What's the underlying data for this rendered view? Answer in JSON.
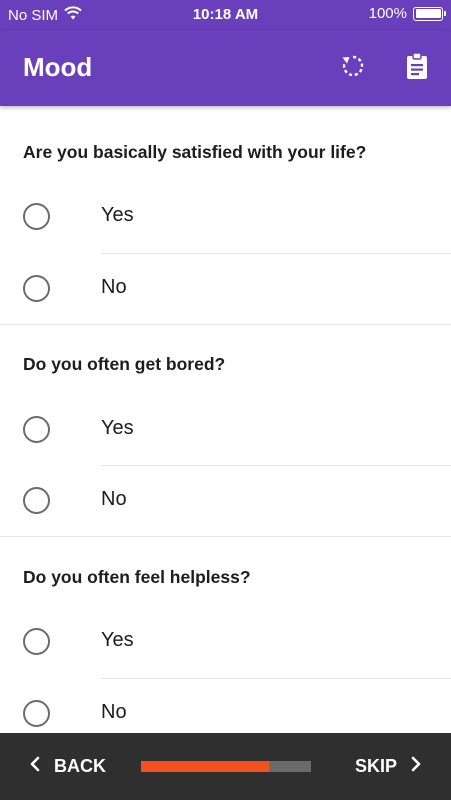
{
  "status_bar": {
    "carrier": "No SIM",
    "time": "10:18 AM",
    "battery": "100%"
  },
  "app_bar": {
    "title": "Mood",
    "restart_icon": "restart-icon",
    "clipboard_icon": "clipboard-icon"
  },
  "questions": [
    {
      "text": "Are you basically satisfied with your life?",
      "options": [
        "Yes",
        "No"
      ]
    },
    {
      "text": "Do you often get bored?",
      "options": [
        "Yes",
        "No"
      ]
    },
    {
      "text": "Do you often feel helpless?",
      "options": [
        "Yes",
        "No"
      ]
    }
  ],
  "bottom_bar": {
    "back_label": "BACK",
    "skip_label": "SKIP",
    "progress_fraction": 0.75
  },
  "colors": {
    "primary": "#6a3fbc",
    "progress_fill": "#f4511e",
    "progress_track": "#6b6b6b",
    "bottom_bar": "#2f2f2f"
  }
}
